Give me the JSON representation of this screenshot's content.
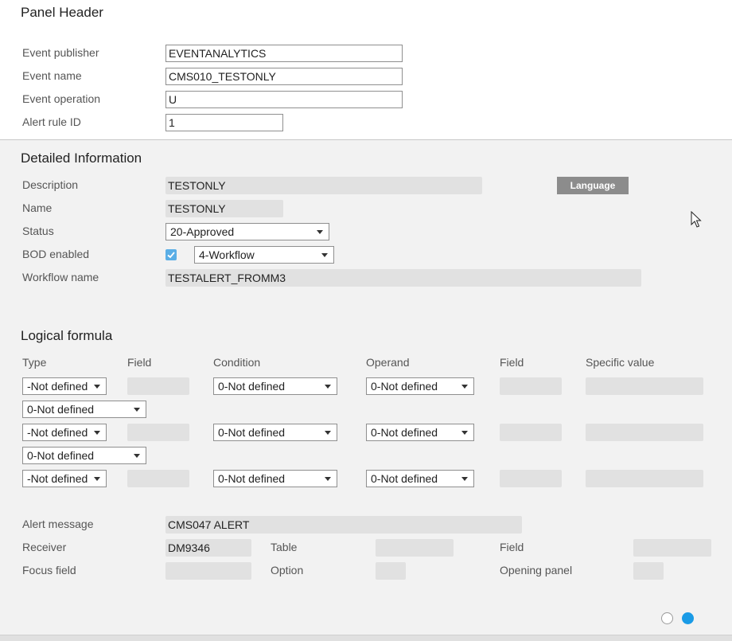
{
  "header": {
    "title": "Panel Header",
    "fields": {
      "publisher_label": "Event publisher",
      "publisher_value": "EVENTANALYTICS",
      "name_label": "Event name",
      "name_value": "CMS010_TESTONLY",
      "operation_label": "Event operation",
      "operation_value": "U",
      "rule_label": "Alert rule ID",
      "rule_value": "1"
    }
  },
  "detail": {
    "title": "Detailed Information",
    "description_label": "Description",
    "description_value": "TESTONLY",
    "language_button": "Language",
    "name_label": "Name",
    "name_value": "TESTONLY",
    "status_label": "Status",
    "status_value": "20-Approved",
    "bod_label": "BOD enabled",
    "bod_checked": true,
    "bod_select_value": "4-Workflow",
    "workflow_label": "Workflow name",
    "workflow_value": "TESTALERT_FROMM3"
  },
  "formula": {
    "title": "Logical formula",
    "columns": [
      "Type",
      "Field",
      "Condition",
      "Operand",
      "Field",
      "Specific value"
    ],
    "rows": [
      {
        "type": "-Not defined",
        "field": "",
        "condition": "0-Not defined",
        "operand": "0-Not defined",
        "field2": "",
        "value": ""
      },
      {
        "type": "-Not defined",
        "field": "",
        "condition": "0-Not defined",
        "operand": "0-Not defined",
        "field2": "",
        "value": ""
      },
      {
        "type": "-Not defined",
        "field": "",
        "condition": "0-Not defined",
        "operand": "0-Not defined",
        "field2": "",
        "value": ""
      }
    ],
    "connectors": [
      "0-Not defined",
      "0-Not defined"
    ]
  },
  "alert": {
    "message_label": "Alert message",
    "message_value": "CMS047 ALERT",
    "receiver_label": "Receiver",
    "receiver_value": "DM9346",
    "table_label": "Table",
    "table_value": "",
    "field_label": "Field",
    "field_value": "",
    "focus_label": "Focus field",
    "focus_value": "",
    "option_label": "Option",
    "option_value": "",
    "opening_label": "Opening panel",
    "opening_value": ""
  },
  "pager": {
    "total": 2,
    "active": 2,
    "active_color": "#1a9be6",
    "inactive_color": "#9a9a9a"
  }
}
